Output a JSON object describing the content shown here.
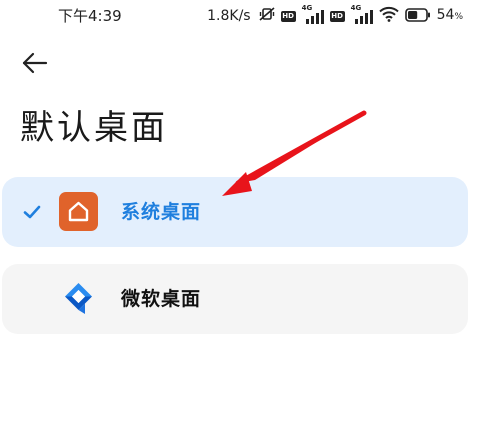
{
  "status_bar": {
    "time": "下午4:39",
    "net_speed": "1.8K/s",
    "hd_badge": "HD",
    "network_type": "4G",
    "battery_percent": "54",
    "battery_suffix": "%",
    "battery_level": 0.54
  },
  "header": {
    "back_icon": "back-arrow-icon",
    "title": "默认桌面"
  },
  "launchers": [
    {
      "label": "系统桌面",
      "selected": true,
      "icon": "home-icon"
    },
    {
      "label": "微软桌面",
      "selected": false,
      "icon": "microsoft-launcher-icon"
    }
  ],
  "colors": {
    "accent": "#1f7fde",
    "selected_bg": "#e3effd",
    "unselected_bg": "#f5f5f5",
    "system_icon_bg": "#e0632b",
    "annotation_arrow": "#e8141b"
  }
}
